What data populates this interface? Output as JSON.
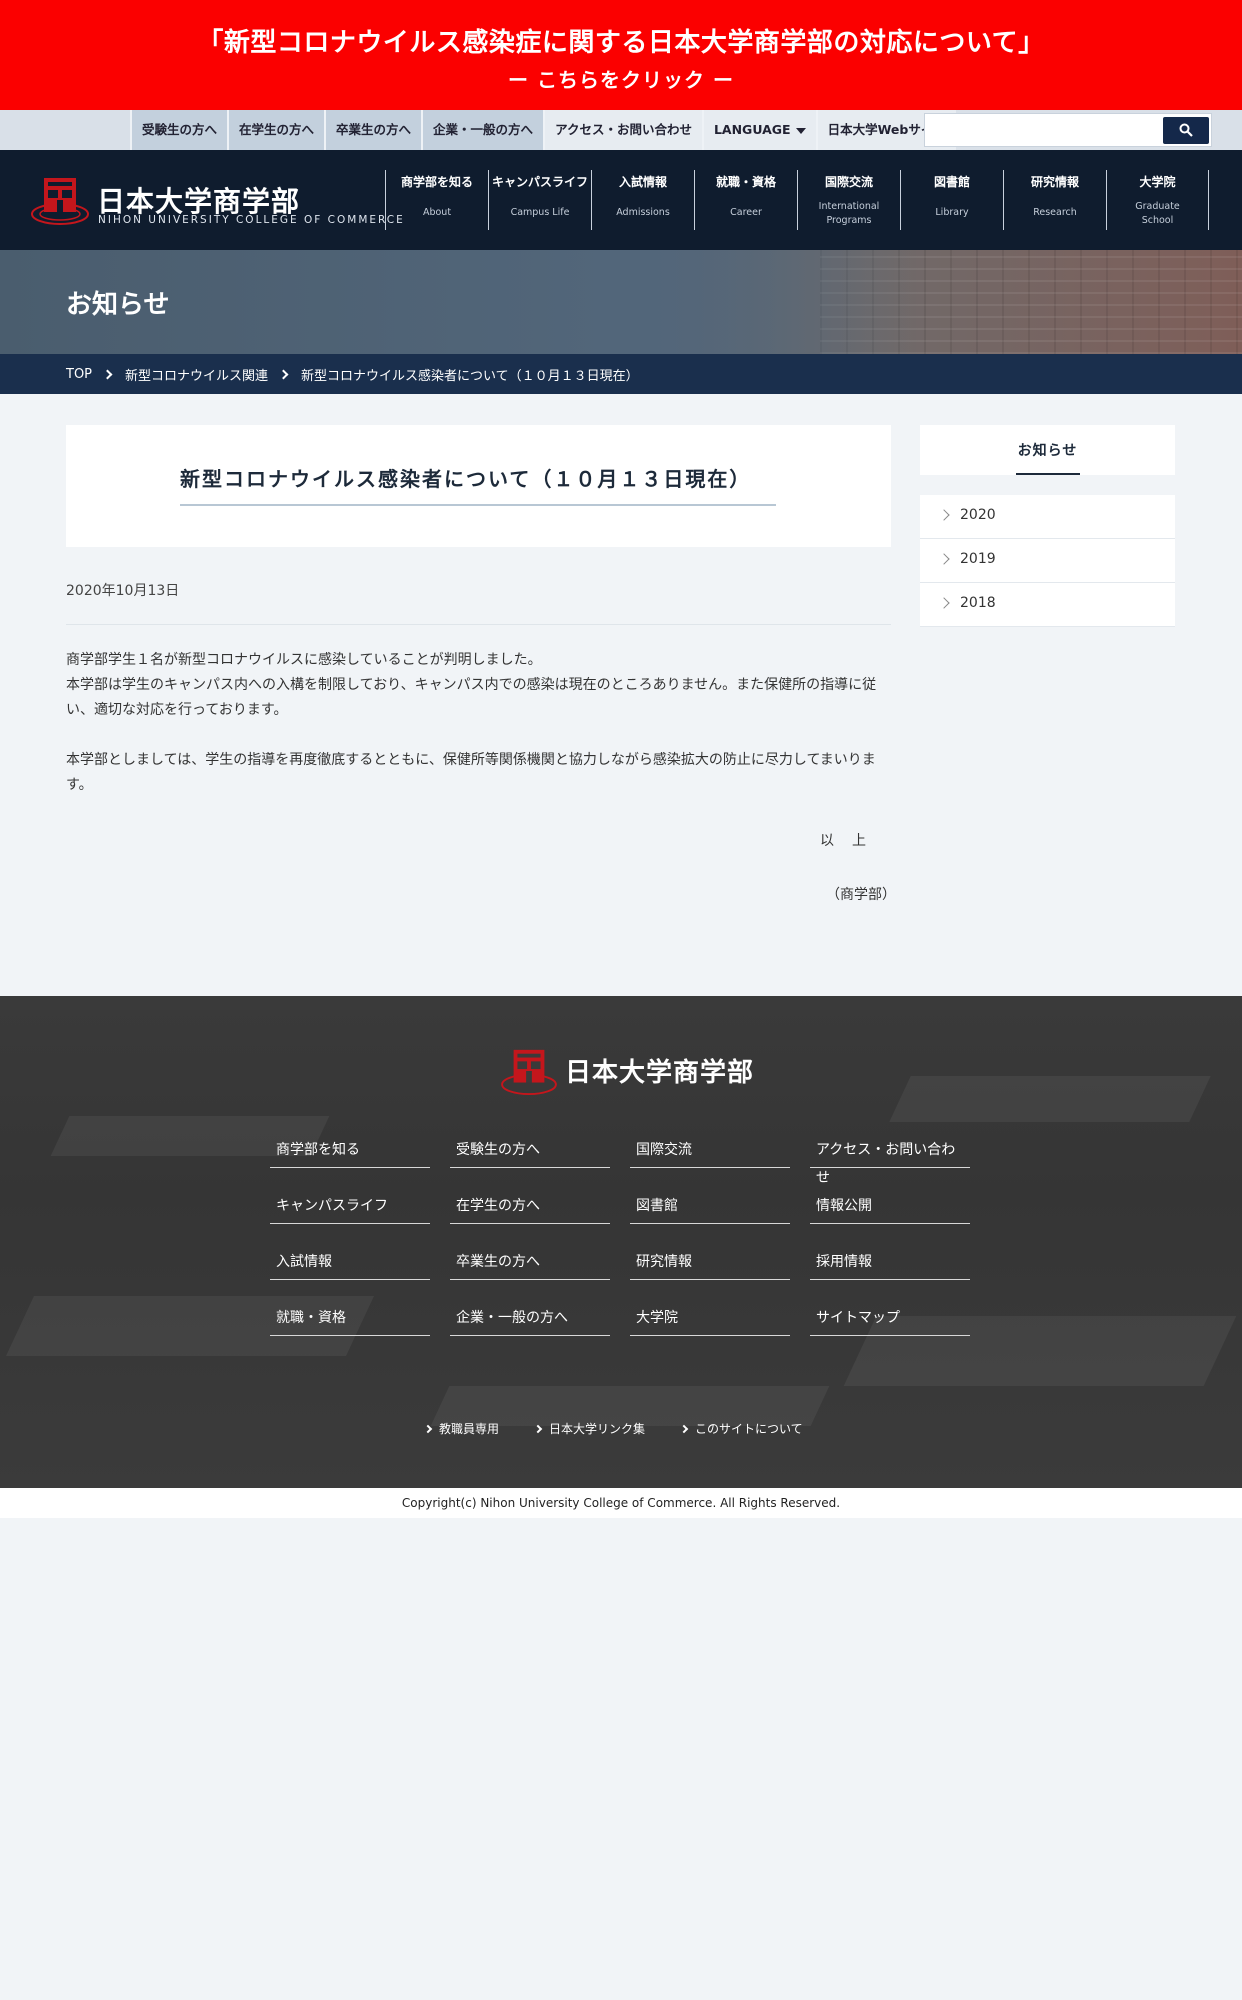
{
  "alert": {
    "line1": "「新型コロナウイルス感染症に関する日本大学商学部の対応について」",
    "line2": "ー こちらをクリック ー",
    "color": "#fb0000"
  },
  "util": {
    "links": [
      "受験生の方へ",
      "在学生の方へ",
      "卒業生の方へ",
      "企業・一般の方へ",
      "アクセス・お問い合わせ",
      "LANGUAGE",
      "日本大学Webサイト"
    ],
    "search_placeholder": ""
  },
  "header": {
    "brand_ja": "日本大学商学部",
    "brand_en": "NIHON UNIVERSITY COLLEGE OF COMMERCE",
    "nav": [
      {
        "ja": "商学部を知る",
        "en": "About"
      },
      {
        "ja": "キャンパスライフ",
        "en": "Campus Life"
      },
      {
        "ja": "入試情報",
        "en": "Admissions"
      },
      {
        "ja": "就職・資格",
        "en": "Career"
      },
      {
        "ja": "国際交流",
        "en": "International Programs"
      },
      {
        "ja": "図書館",
        "en": "Library"
      },
      {
        "ja": "研究情報",
        "en": "Research"
      },
      {
        "ja": "大学院",
        "en": "Graduate School"
      }
    ]
  },
  "page": {
    "title": "お知らせ",
    "breadcrumb": [
      "TOP",
      "新型コロナウイルス関連",
      "新型コロナウイルス感染者について（１０月１３日現在）"
    ]
  },
  "article": {
    "heading": "新型コロナウイルス感染者について（１０月１３日現在）",
    "date": "2020年10月13日",
    "p1_line1": "商学部学生１名が新型コロナウイルスに感染していることが判明しました。",
    "p1_line2": "本学部は学生のキャンパス内への入構を制限しており、キャンパス内での感染は現在のところありません。また保健所の指導に従い、適切な対応を行っております。",
    "p2": "本学部としましては、学生の指導を再度徹底するとともに、保健所等関係機関と協力しながら感染拡大の防止に尽力してまいります。",
    "closing": "以上",
    "signature": "（商学部）"
  },
  "sidebar": {
    "title": "お知らせ",
    "years": [
      "2020",
      "2019",
      "2018"
    ]
  },
  "footer": {
    "brand": "日本大学商学部",
    "links": [
      "商学部を知る",
      "受験生の方へ",
      "国際交流",
      "アクセス・お問い合わせ",
      "キャンパスライフ",
      "在学生の方へ",
      "図書館",
      "情報公開",
      "入試情報",
      "卒業生の方へ",
      "研究情報",
      "採用情報",
      "就職・資格",
      "企業・一般の方へ",
      "大学院",
      "サイトマップ"
    ],
    "sublinks": [
      "教職員専用",
      "日本大学リンク集",
      "このサイトについて"
    ],
    "copyright": "Copyright(c) Nihon University College of Commerce. All Rights Reserved."
  }
}
